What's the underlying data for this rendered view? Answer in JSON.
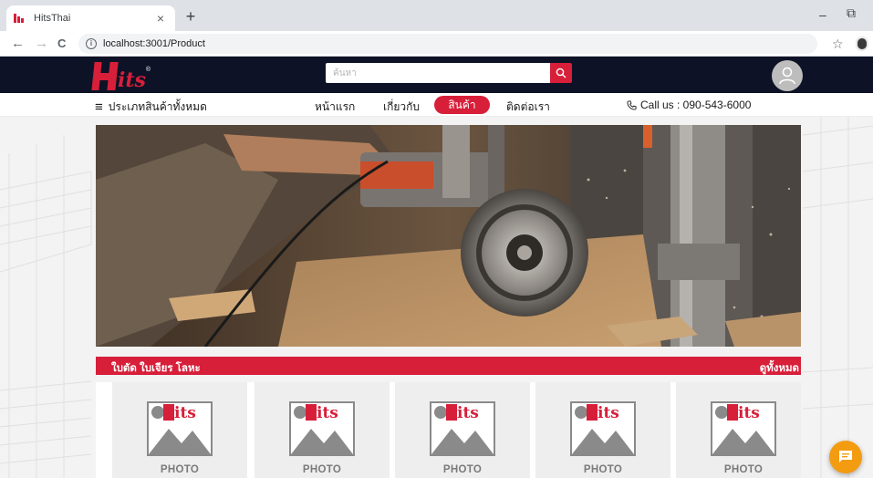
{
  "browser": {
    "tab_title": "HitsThai",
    "tab_close": "×",
    "new_tab": "+",
    "minimize": "–",
    "maximize": "⧉",
    "back": "←",
    "forward": "→",
    "reload": "C",
    "info": "i",
    "url": "localhost:3001/Product",
    "bookmark": "☆"
  },
  "header": {
    "logo_text": "its",
    "logo_reg": "®",
    "search_placeholder": "ค้นหา"
  },
  "nav": {
    "categories_icon": "≡",
    "categories_label": "ประเภทสินค้าทั้งหมด",
    "links": [
      "หน้าแรก",
      "เกี่ยวกับ",
      "สินค้า",
      "ติดต่อเรา"
    ],
    "active": "สินค้า",
    "call_us": "Call us : 090-543-6000"
  },
  "section": {
    "title": "ใบตัด ใบเจียร โลหะ",
    "view_all": "ดูทั้งหมด"
  },
  "products": [
    {
      "logo": "its",
      "label": "PHOTO"
    },
    {
      "logo": "its",
      "label": "PHOTO"
    },
    {
      "logo": "its",
      "label": "PHOTO"
    },
    {
      "logo": "its",
      "label": "PHOTO"
    },
    {
      "logo": "its",
      "label": "PHOTO"
    }
  ],
  "colors": {
    "brand_red": "#d71f3a",
    "header_navy": "#0d1226",
    "chat_orange": "#f39c12"
  },
  "icons": [
    "hits-favicon",
    "info-icon",
    "star-icon",
    "search-icon",
    "user-avatar-icon",
    "hamburger-icon",
    "phone-icon",
    "chat-icon"
  ]
}
